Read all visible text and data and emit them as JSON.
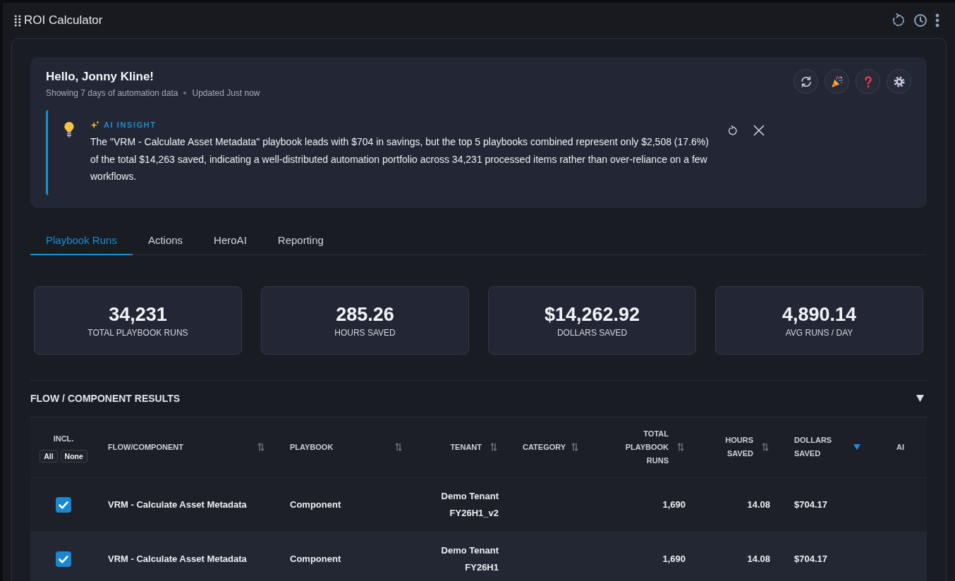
{
  "window": {
    "title": "ROI Calculator"
  },
  "greeting": {
    "title": "Hello, Jonny Kline!",
    "range_note": "Showing 7 days of automation data",
    "updated_note": "Updated Just now"
  },
  "insight": {
    "label": "AI INSIGHT",
    "text": "The \"VRM - Calculate Asset Metadata\" playbook leads with $704 in savings, but the top 5 playbooks combined represent only $2,508 (17.6%) of the total $14,263 saved, indicating a well-distributed automation portfolio across 34,231 processed items rather than over-reliance on a few workflows."
  },
  "tabs": [
    {
      "label": "Playbook Runs",
      "selected": true
    },
    {
      "label": "Actions",
      "selected": false
    },
    {
      "label": "HeroAI",
      "selected": false
    },
    {
      "label": "Reporting",
      "selected": false
    }
  ],
  "stats": [
    {
      "value": "34,231",
      "label": "TOTAL PLAYBOOK RUNS"
    },
    {
      "value": "285.26",
      "label": "HOURS SAVED"
    },
    {
      "value": "$14,262.92",
      "label": "DOLLARS SAVED"
    },
    {
      "value": "4,890.14",
      "label": "AVG RUNS / DAY"
    }
  ],
  "results": {
    "title": "FLOW / COMPONENT RESULTS",
    "expanded": true
  },
  "table": {
    "columns": [
      {
        "label": "INCL.",
        "buttons": [
          "All",
          "None"
        ]
      },
      {
        "label": "FLOW/COMPONENT",
        "sorted": false
      },
      {
        "label": "PLAYBOOK",
        "sorted": false
      },
      {
        "label": "TENANT",
        "sorted": false
      },
      {
        "label": "CATEGORY",
        "sorted": false
      },
      {
        "label": "TOTAL PLAYBOOK RUNS",
        "sorted": false
      },
      {
        "label": "HOURS SAVED",
        "sorted": false
      },
      {
        "label": "DOLLARS SAVED",
        "sorted": true
      },
      {
        "label": "AI"
      }
    ],
    "rows": [
      {
        "included": true,
        "flow_component": "VRM - Calculate Asset Metadata",
        "playbook": "Component",
        "tenant": "Demo Tenant FY26H1_v2",
        "total_playbook_runs": "1,690",
        "hours_saved": "14.08",
        "dollars_saved": "$704.17"
      },
      {
        "included": true,
        "flow_component": "VRM - Calculate Asset Metadata",
        "playbook": "Component",
        "tenant": "Demo Tenant FY26H1",
        "total_playbook_runs": "1,690",
        "hours_saved": "14.08",
        "dollars_saved": "$704.17"
      }
    ]
  }
}
